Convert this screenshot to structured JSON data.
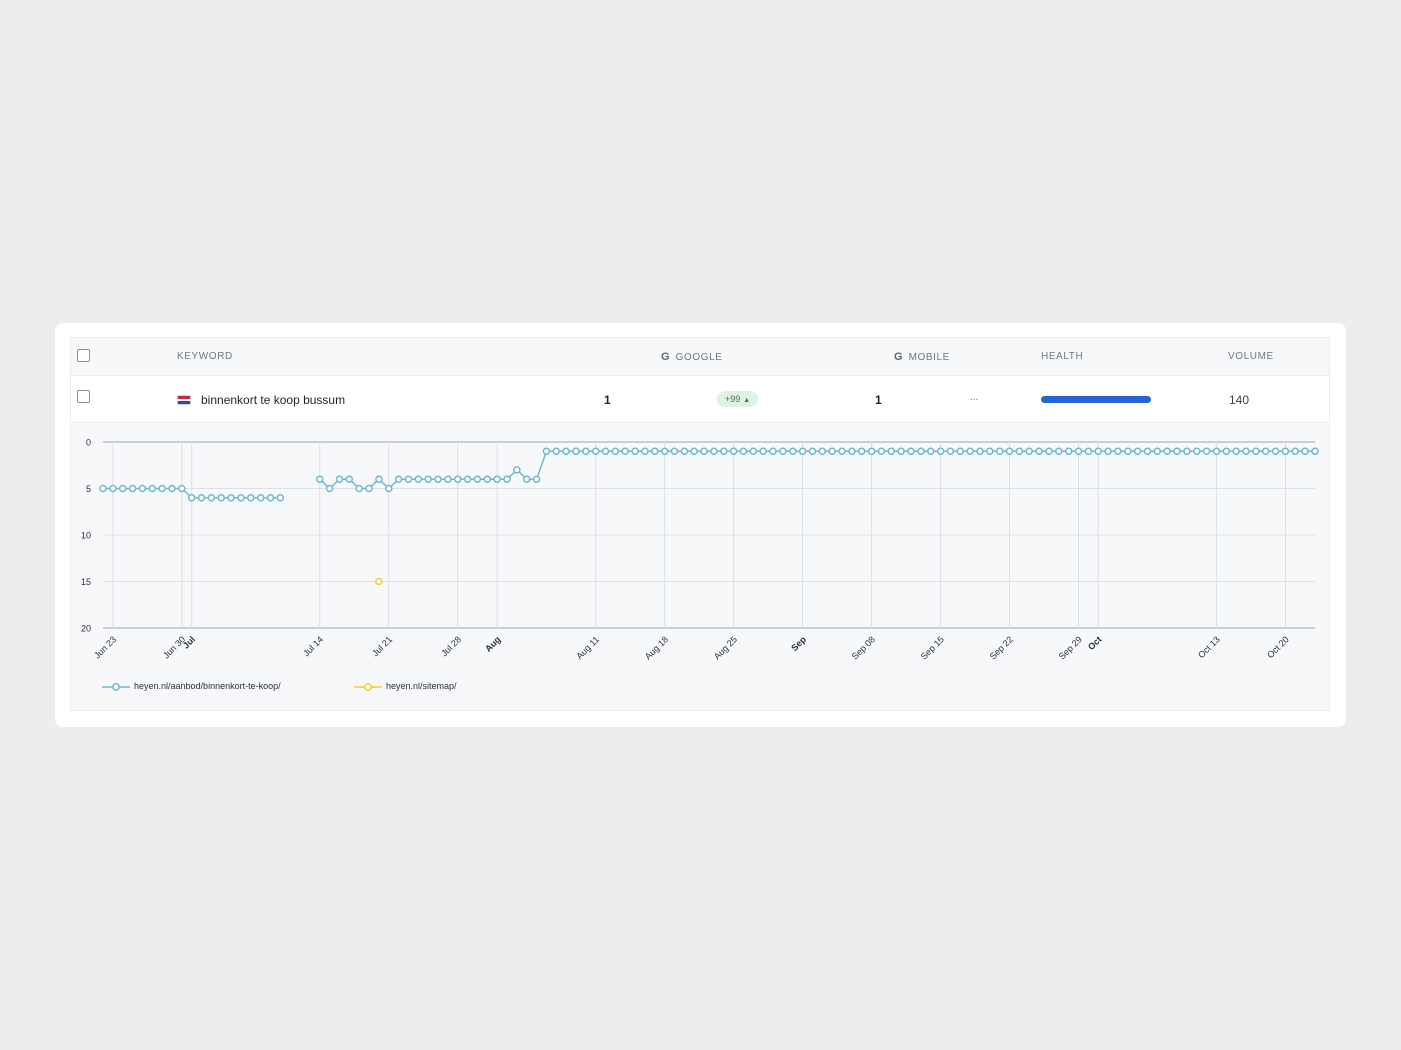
{
  "table": {
    "headers": {
      "keyword": "KEYWORD",
      "google": "GOOGLE",
      "mobile": "MOBILE",
      "health": "HEALTH",
      "volume": "VOLUME"
    },
    "google_icon": "G",
    "row": {
      "flag": "flag-netherlands-icon",
      "keyword": "binnenkort te koop bussum",
      "google_rank": "1",
      "change": "+99",
      "change_arrow": "▲",
      "mobile_rank": "1",
      "mobile_extra": "...",
      "health_fraction": 1.0,
      "volume": "140"
    }
  },
  "colors": {
    "series_blue": "#6fb9cf",
    "series_yellow": "#f2cf2a",
    "health_bar": "#2563d6",
    "badge_bg": "#dff3e4",
    "badge_text": "#2e7d4a"
  },
  "chart_data": {
    "type": "line",
    "y_reversed": true,
    "ylim": [
      0,
      20
    ],
    "y_ticks": [
      0,
      5,
      10,
      15,
      20
    ],
    "grid": true,
    "legend_position": "bottom-left",
    "x_start": "2024-06-22",
    "x_end": "2024-10-23",
    "x_ticks": [
      {
        "date": "2024-06-23",
        "label": "Jun 23",
        "bold": false
      },
      {
        "date": "2024-06-30",
        "label": "Jun 30",
        "bold": false
      },
      {
        "date": "2024-07-01",
        "label": "Jul",
        "bold": true
      },
      {
        "date": "2024-07-14",
        "label": "Jul 14",
        "bold": false
      },
      {
        "date": "2024-07-21",
        "label": "Jul 21",
        "bold": false
      },
      {
        "date": "2024-07-28",
        "label": "Jul 28",
        "bold": false
      },
      {
        "date": "2024-08-01",
        "label": "Aug",
        "bold": true
      },
      {
        "date": "2024-08-11",
        "label": "Aug 11",
        "bold": false
      },
      {
        "date": "2024-08-18",
        "label": "Aug 18",
        "bold": false
      },
      {
        "date": "2024-08-25",
        "label": "Aug 25",
        "bold": false
      },
      {
        "date": "2024-09-01",
        "label": "Sep",
        "bold": true
      },
      {
        "date": "2024-09-08",
        "label": "Sep 08",
        "bold": false
      },
      {
        "date": "2024-09-15",
        "label": "Sep 15",
        "bold": false
      },
      {
        "date": "2024-09-22",
        "label": "Sep 22",
        "bold": false
      },
      {
        "date": "2024-09-29",
        "label": "Sep 29",
        "bold": false
      },
      {
        "date": "2024-10-01",
        "label": "Oct",
        "bold": true
      },
      {
        "date": "2024-10-13",
        "label": "Oct 13",
        "bold": false
      },
      {
        "date": "2024-10-20",
        "label": "Oct 20",
        "bold": false
      }
    ],
    "series": [
      {
        "name": "heyen.nl/aanbod/binnenkort-te-koop/",
        "color": "#6fb9cf",
        "segments": [
          [
            [
              "2024-06-22",
              5
            ],
            [
              "2024-06-23",
              5
            ],
            [
              "2024-06-24",
              5
            ],
            [
              "2024-06-25",
              5
            ],
            [
              "2024-06-26",
              5
            ],
            [
              "2024-06-27",
              5
            ],
            [
              "2024-06-28",
              5
            ],
            [
              "2024-06-29",
              5
            ],
            [
              "2024-06-30",
              5
            ],
            [
              "2024-07-01",
              6
            ],
            [
              "2024-07-02",
              6
            ],
            [
              "2024-07-03",
              6
            ],
            [
              "2024-07-04",
              6
            ],
            [
              "2024-07-05",
              6
            ],
            [
              "2024-07-06",
              6
            ],
            [
              "2024-07-07",
              6
            ],
            [
              "2024-07-08",
              6
            ],
            [
              "2024-07-09",
              6
            ],
            [
              "2024-07-10",
              6
            ]
          ],
          [
            [
              "2024-07-14",
              4
            ],
            [
              "2024-07-15",
              5
            ],
            [
              "2024-07-16",
              4
            ],
            [
              "2024-07-17",
              4
            ],
            [
              "2024-07-18",
              5
            ],
            [
              "2024-07-19",
              5
            ],
            [
              "2024-07-20",
              4
            ],
            [
              "2024-07-21",
              5
            ],
            [
              "2024-07-22",
              4
            ],
            [
              "2024-07-23",
              4
            ],
            [
              "2024-07-24",
              4
            ],
            [
              "2024-07-25",
              4
            ],
            [
              "2024-07-26",
              4
            ],
            [
              "2024-07-27",
              4
            ],
            [
              "2024-07-28",
              4
            ],
            [
              "2024-07-29",
              4
            ],
            [
              "2024-07-30",
              4
            ],
            [
              "2024-07-31",
              4
            ],
            [
              "2024-08-01",
              4
            ],
            [
              "2024-08-02",
              4
            ],
            [
              "2024-08-03",
              3
            ],
            [
              "2024-08-04",
              4
            ],
            [
              "2024-08-05",
              4
            ],
            [
              "2024-08-06",
              1
            ],
            [
              "2024-08-07",
              1
            ],
            [
              "2024-08-08",
              1
            ],
            [
              "2024-08-09",
              1
            ],
            [
              "2024-08-10",
              1
            ],
            [
              "2024-08-11",
              1
            ],
            [
              "2024-08-12",
              1
            ],
            [
              "2024-08-13",
              1
            ],
            [
              "2024-08-14",
              1
            ],
            [
              "2024-08-15",
              1
            ],
            [
              "2024-08-16",
              1
            ],
            [
              "2024-08-17",
              1
            ],
            [
              "2024-08-18",
              1
            ],
            [
              "2024-08-19",
              1
            ],
            [
              "2024-08-20",
              1
            ],
            [
              "2024-08-21",
              1
            ],
            [
              "2024-08-22",
              1
            ],
            [
              "2024-08-23",
              1
            ],
            [
              "2024-08-24",
              1
            ],
            [
              "2024-08-25",
              1
            ],
            [
              "2024-08-26",
              1
            ],
            [
              "2024-08-27",
              1
            ],
            [
              "2024-08-28",
              1
            ],
            [
              "2024-08-29",
              1
            ],
            [
              "2024-08-30",
              1
            ],
            [
              "2024-08-31",
              1
            ],
            [
              "2024-09-01",
              1
            ],
            [
              "2024-09-02",
              1
            ],
            [
              "2024-09-03",
              1
            ],
            [
              "2024-09-04",
              1
            ],
            [
              "2024-09-05",
              1
            ],
            [
              "2024-09-06",
              1
            ],
            [
              "2024-09-07",
              1
            ],
            [
              "2024-09-08",
              1
            ],
            [
              "2024-09-09",
              1
            ],
            [
              "2024-09-10",
              1
            ],
            [
              "2024-09-11",
              1
            ],
            [
              "2024-09-12",
              1
            ],
            [
              "2024-09-13",
              1
            ],
            [
              "2024-09-14",
              1
            ],
            [
              "2024-09-15",
              1
            ],
            [
              "2024-09-16",
              1
            ],
            [
              "2024-09-17",
              1
            ],
            [
              "2024-09-18",
              1
            ],
            [
              "2024-09-19",
              1
            ],
            [
              "2024-09-20",
              1
            ],
            [
              "2024-09-21",
              1
            ],
            [
              "2024-09-22",
              1
            ],
            [
              "2024-09-23",
              1
            ],
            [
              "2024-09-24",
              1
            ],
            [
              "2024-09-25",
              1
            ],
            [
              "2024-09-26",
              1
            ],
            [
              "2024-09-27",
              1
            ],
            [
              "2024-09-28",
              1
            ],
            [
              "2024-09-29",
              1
            ],
            [
              "2024-09-30",
              1
            ],
            [
              "2024-10-01",
              1
            ],
            [
              "2024-10-02",
              1
            ],
            [
              "2024-10-03",
              1
            ],
            [
              "2024-10-04",
              1
            ],
            [
              "2024-10-05",
              1
            ],
            [
              "2024-10-06",
              1
            ],
            [
              "2024-10-07",
              1
            ],
            [
              "2024-10-08",
              1
            ],
            [
              "2024-10-09",
              1
            ],
            [
              "2024-10-10",
              1
            ],
            [
              "2024-10-11",
              1
            ],
            [
              "2024-10-12",
              1
            ],
            [
              "2024-10-13",
              1
            ],
            [
              "2024-10-14",
              1
            ],
            [
              "2024-10-15",
              1
            ],
            [
              "2024-10-16",
              1
            ],
            [
              "2024-10-17",
              1
            ],
            [
              "2024-10-18",
              1
            ],
            [
              "2024-10-19",
              1
            ],
            [
              "2024-10-20",
              1
            ],
            [
              "2024-10-21",
              1
            ],
            [
              "2024-10-22",
              1
            ],
            [
              "2024-10-23",
              1
            ]
          ]
        ]
      },
      {
        "name": "heyen.nl/sitemap/",
        "color": "#f2cf2a",
        "segments": [
          [
            [
              "2024-07-20",
              15
            ]
          ]
        ]
      }
    ]
  }
}
